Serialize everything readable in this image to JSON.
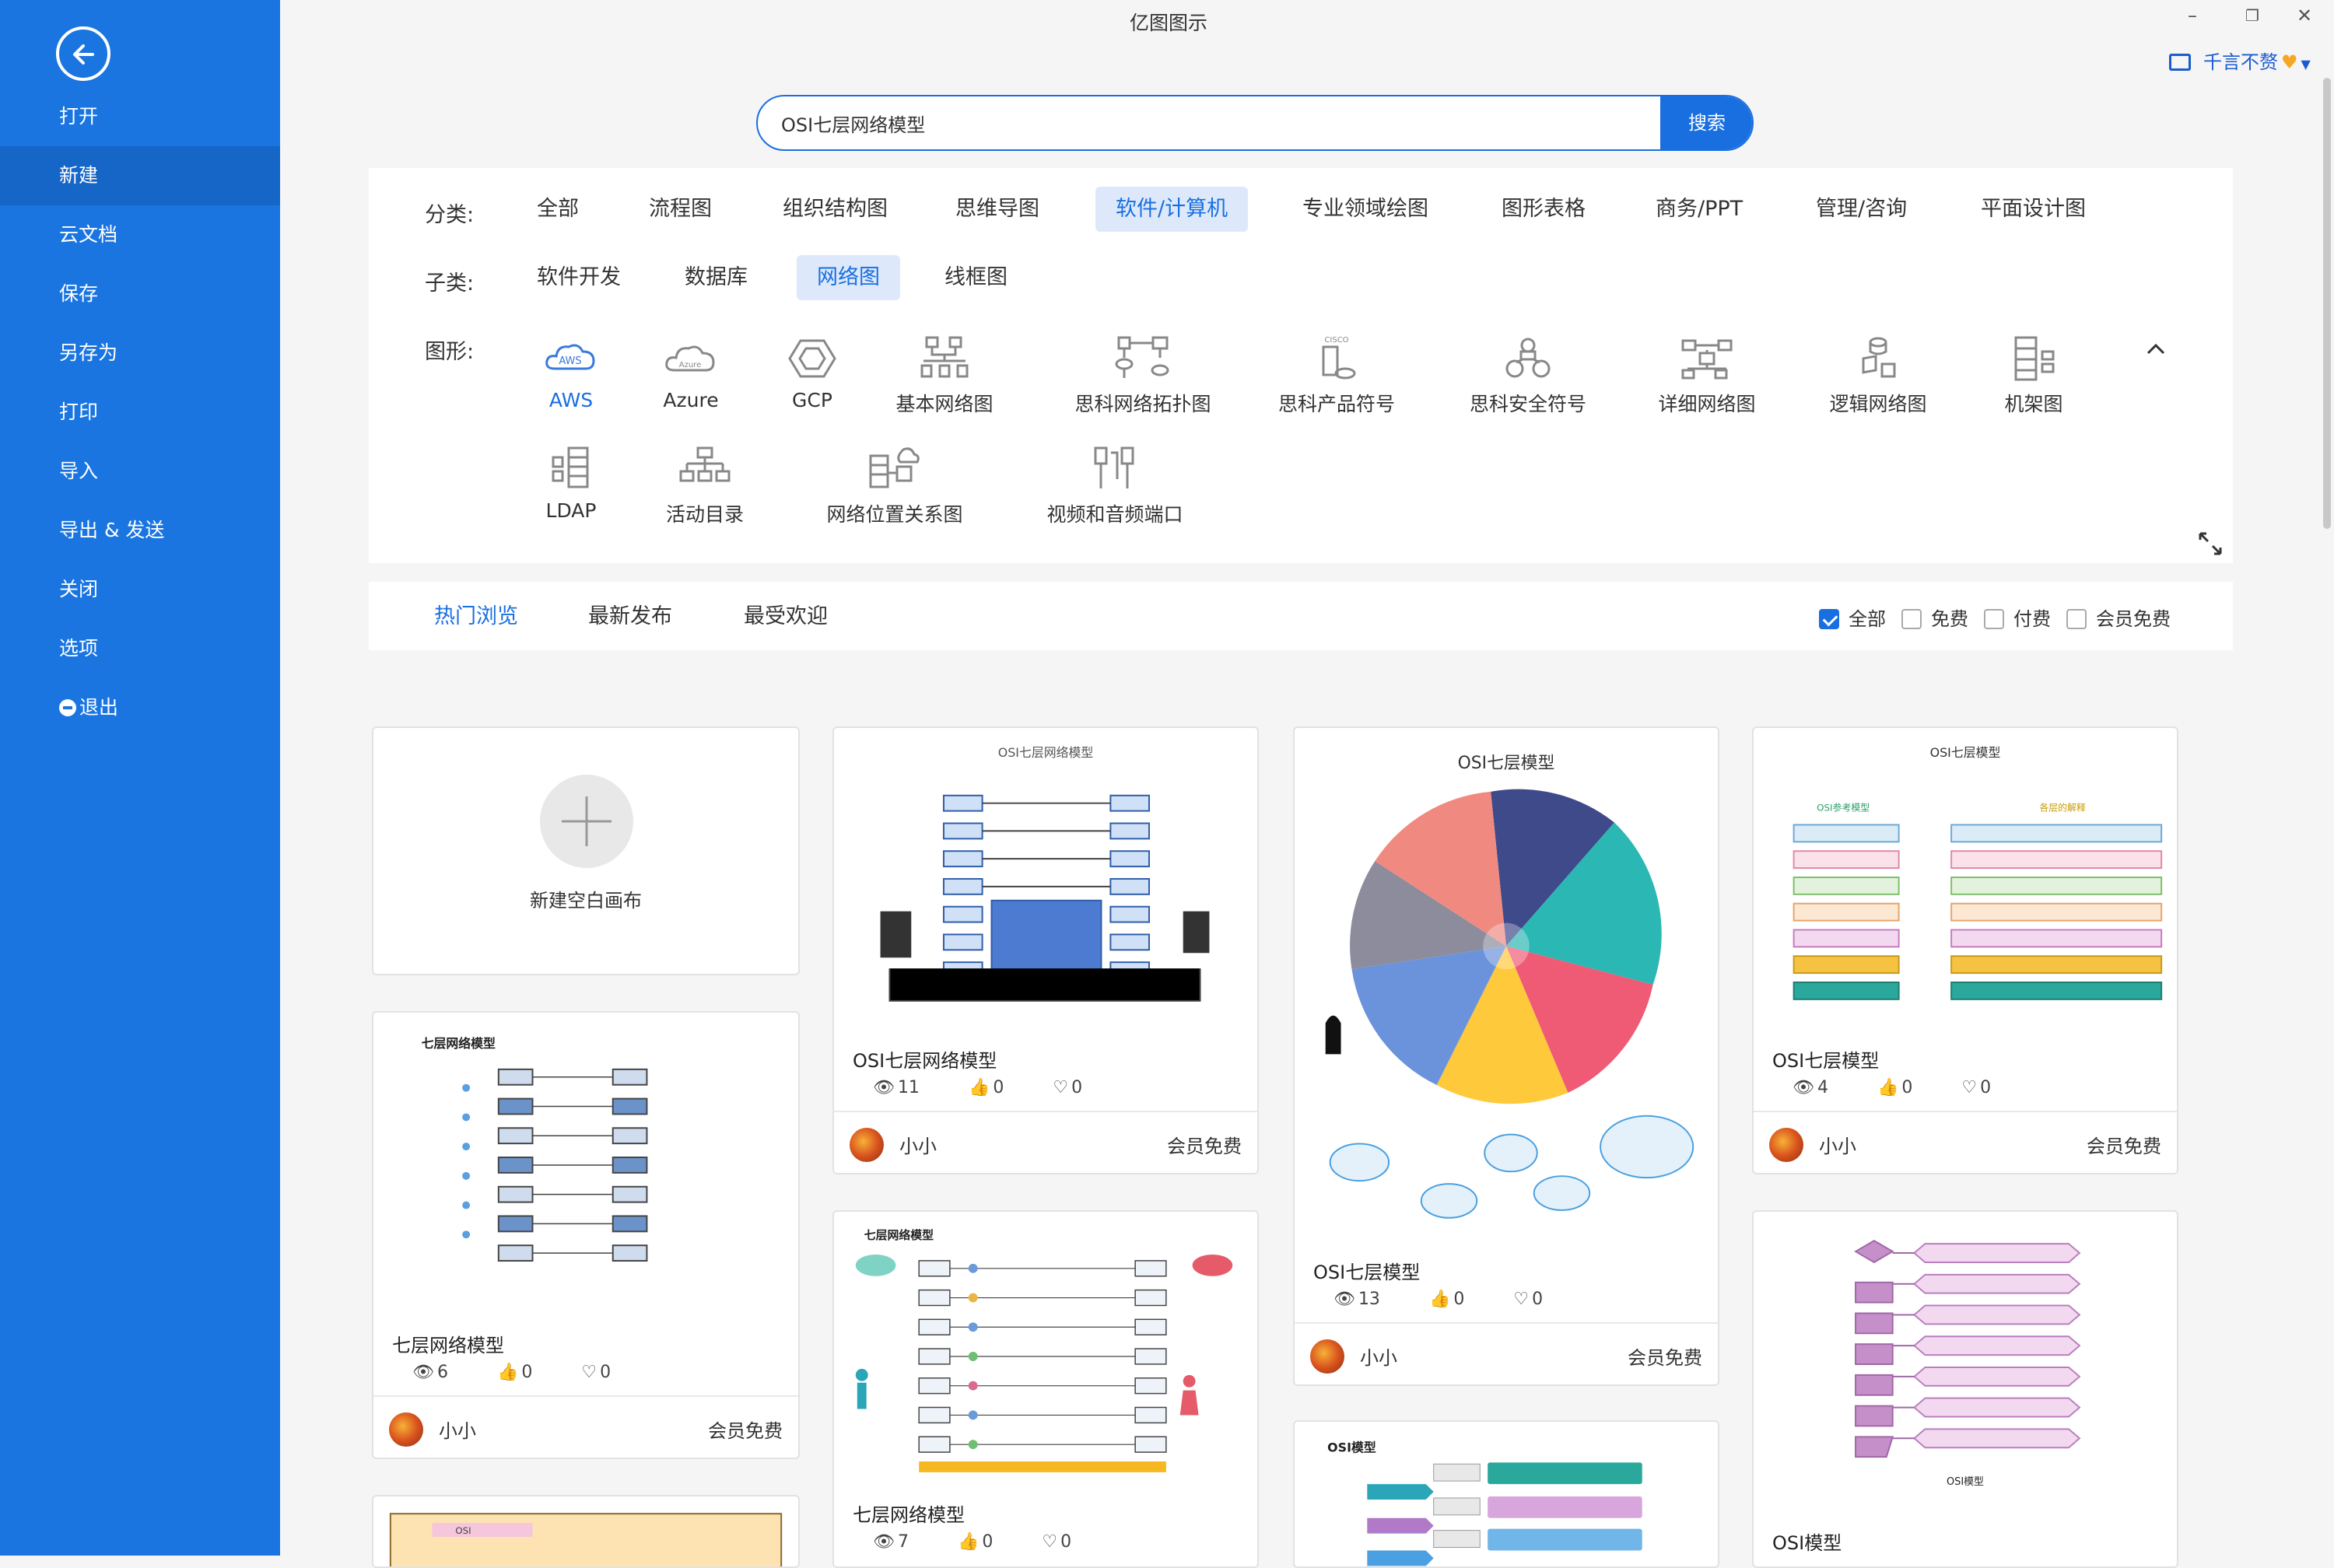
{
  "app": {
    "title": "亿图图示"
  },
  "user": {
    "name": "千言不赘"
  },
  "sidebar": {
    "items": [
      {
        "label": "打开"
      },
      {
        "label": "新建"
      },
      {
        "label": "云文档"
      },
      {
        "label": "保存"
      },
      {
        "label": "另存为"
      },
      {
        "label": "打印"
      },
      {
        "label": "导入"
      },
      {
        "label": "导出 & 发送"
      },
      {
        "label": "关闭"
      },
      {
        "label": "选项"
      },
      {
        "label": "退出"
      }
    ],
    "active": "新建"
  },
  "search": {
    "value": "OSI七层网络模型",
    "button": "搜索"
  },
  "filters": {
    "category_label": "分类:",
    "categories": [
      "全部",
      "流程图",
      "组织结构图",
      "思维导图",
      "软件/计算机",
      "专业领域绘图",
      "图形表格",
      "商务/PPT",
      "管理/咨询",
      "平面设计图"
    ],
    "category_selected": "软件/计算机",
    "subcategory_label": "子类:",
    "subcategories": [
      "软件开发",
      "数据库",
      "网络图",
      "线框图"
    ],
    "subcategory_selected": "网络图",
    "shape_label": "图形:",
    "shapes": [
      "AWS",
      "Azure",
      "GCP",
      "基本网络图",
      "思科网络拓扑图",
      "思科产品符号",
      "思科安全符号",
      "详细网络图",
      "逻辑网络图",
      "机架图",
      "LDAP",
      "活动目录",
      "网络位置关系图",
      "视频和音频端口"
    ],
    "shape_selected": "AWS",
    "aws_icon_text": "AWS",
    "azure_icon_text": "Azure",
    "cisco_icon_text": "CISCO"
  },
  "tabs": {
    "items": [
      "热门浏览",
      "最新发布",
      "最受欢迎"
    ],
    "selected": "热门浏览",
    "checkboxes": [
      {
        "label": "全部",
        "checked": true
      },
      {
        "label": "免费",
        "checked": false
      },
      {
        "label": "付费",
        "checked": false
      },
      {
        "label": "会员免费",
        "checked": false
      }
    ]
  },
  "cards": {
    "new_canvas": "新建空白画布",
    "c1": {
      "title": "OSI七层网络模型",
      "views": "11",
      "likes": "0",
      "favs": "0",
      "author": "小小",
      "badge": "会员免费",
      "thumb_title": "OSI七层网络模型"
    },
    "c2": {
      "title": "OSI七层模型",
      "views": "13",
      "likes": "0",
      "favs": "0",
      "author": "小小",
      "badge": "会员免费",
      "thumb_title": "OSI七层模型"
    },
    "c3": {
      "title": "OSI七层模型",
      "views": "4",
      "likes": "0",
      "favs": "0",
      "author": "小小",
      "badge": "会员免费",
      "thumb_title": "OSI七层模型",
      "left_head": "OSI参考模型",
      "right_head": "各层的解释"
    },
    "c4": {
      "title": "七层网络模型",
      "views": "6",
      "likes": "0",
      "favs": "0",
      "author": "小小",
      "badge": "会员免费",
      "thumb_title": "七层网络模型"
    },
    "c5": {
      "title": "七层网络模型",
      "views": "7",
      "likes": "0",
      "favs": "0",
      "thumb_title": "七层网络模型"
    },
    "c6": {
      "thumb_title": "OSI模型"
    },
    "c7": {
      "title": "OSI模型",
      "thumb_title": "OSI模型"
    },
    "c8": {
      "thumb_title": "OSI"
    }
  }
}
